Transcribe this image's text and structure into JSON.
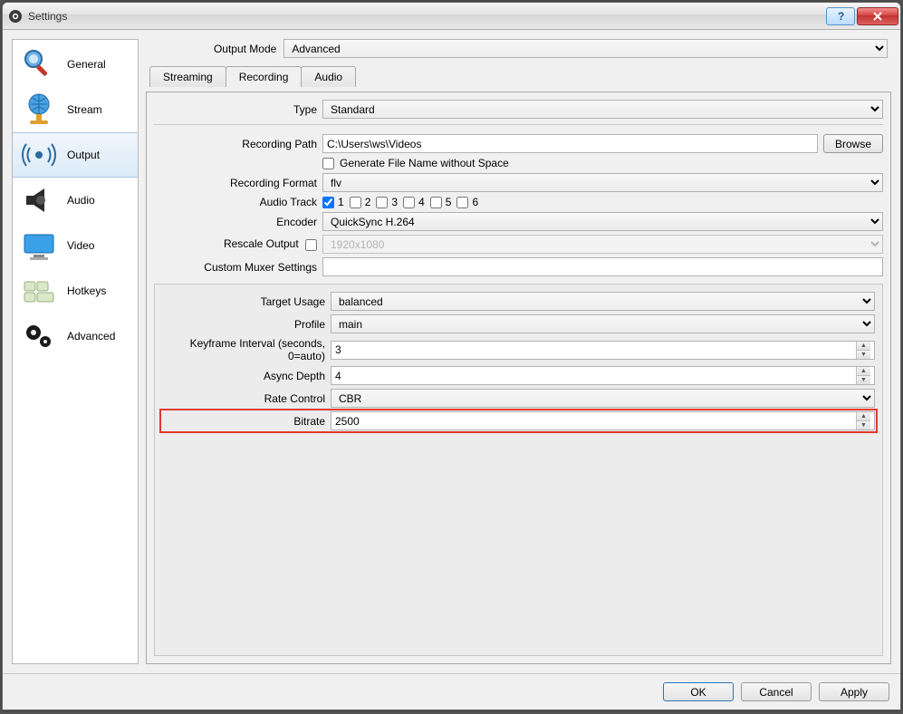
{
  "window": {
    "title": "Settings"
  },
  "sidebar": {
    "items": [
      {
        "label": "General"
      },
      {
        "label": "Stream"
      },
      {
        "label": "Output"
      },
      {
        "label": "Audio"
      },
      {
        "label": "Video"
      },
      {
        "label": "Hotkeys"
      },
      {
        "label": "Advanced"
      }
    ]
  },
  "output_mode_label": "Output Mode",
  "output_mode_value": "Advanced",
  "tabs": {
    "streaming": "Streaming",
    "recording": "Recording",
    "audio": "Audio"
  },
  "rec": {
    "type_label": "Type",
    "type_value": "Standard",
    "path_label": "Recording Path",
    "path_value": "C:\\Users\\ws\\Videos",
    "browse": "Browse",
    "no_space_label": "Generate File Name without Space",
    "format_label": "Recording Format",
    "format_value": "flv",
    "track_label": "Audio Track",
    "tracks": [
      "1",
      "2",
      "3",
      "4",
      "5",
      "6"
    ],
    "encoder_label": "Encoder",
    "encoder_value": "QuickSync H.264",
    "rescale_label": "Rescale Output",
    "rescale_value": "1920x1080",
    "muxer_label": "Custom Muxer Settings",
    "muxer_value": ""
  },
  "enc": {
    "target_label": "Target Usage",
    "target_value": "balanced",
    "profile_label": "Profile",
    "profile_value": "main",
    "keyframe_label": "Keyframe Interval (seconds, 0=auto)",
    "keyframe_value": "3",
    "async_label": "Async Depth",
    "async_value": "4",
    "rate_label": "Rate Control",
    "rate_value": "CBR",
    "bitrate_label": "Bitrate",
    "bitrate_value": "2500"
  },
  "footer": {
    "ok": "OK",
    "cancel": "Cancel",
    "apply": "Apply"
  }
}
